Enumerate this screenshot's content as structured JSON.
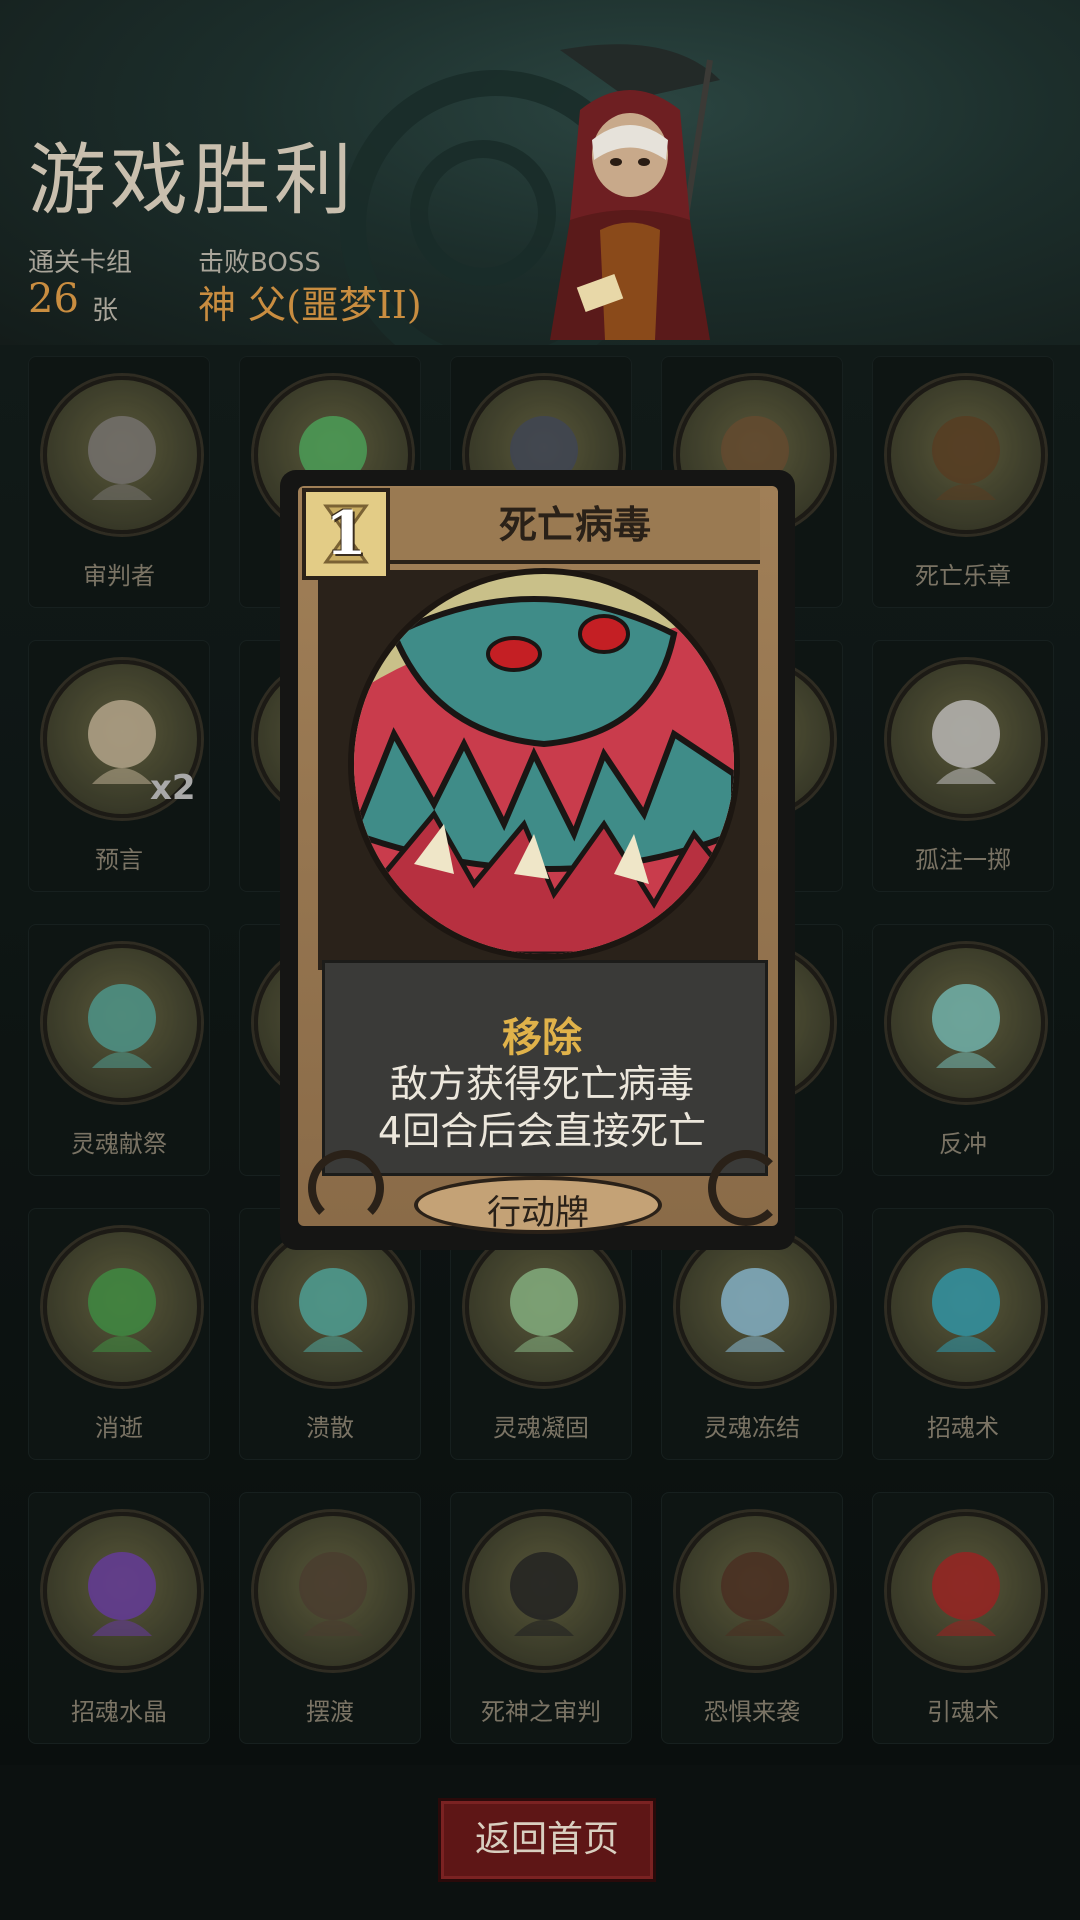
{
  "header": {
    "title": "游戏胜利",
    "cleared_deck_label": "通关卡组",
    "cleared_deck_count": "26",
    "cleared_deck_unit": "张",
    "boss_label": "击败BOSS",
    "boss_name": "神 父(噩梦II)"
  },
  "cards": [
    {
      "name": "审判者",
      "icon": "scythe-icon"
    },
    {
      "name": "",
      "icon": "lantern-icon"
    },
    {
      "name": "",
      "icon": "hooded-figure-icon"
    },
    {
      "name": "",
      "icon": "lute-icon"
    },
    {
      "name": "死亡乐章",
      "icon": "treasure-chest-icon"
    },
    {
      "name": "预言",
      "icon": "prophet-icon",
      "badge": "x2"
    },
    {
      "name": "",
      "icon": "card-icon"
    },
    {
      "name": "",
      "icon": "card-icon"
    },
    {
      "name": "",
      "icon": "card-icon"
    },
    {
      "name": "孤注一掷",
      "icon": "dice-icon"
    },
    {
      "name": "灵魂献祭",
      "icon": "ghost-sacrifice-icon"
    },
    {
      "name": "",
      "icon": "card-icon"
    },
    {
      "name": "",
      "icon": "card-icon"
    },
    {
      "name": "",
      "icon": "card-icon"
    },
    {
      "name": "反冲",
      "icon": "magic-circle-icon"
    },
    {
      "name": "消逝",
      "icon": "vortex-icon"
    },
    {
      "name": "溃散",
      "icon": "skull-ghost-icon"
    },
    {
      "name": "灵魂凝固",
      "icon": "green-ghost-icon"
    },
    {
      "name": "灵魂冻结",
      "icon": "ice-crystal-icon"
    },
    {
      "name": "招魂术",
      "icon": "blue-splash-icon"
    },
    {
      "name": "招魂水晶",
      "icon": "crystal-icon"
    },
    {
      "name": "摆渡",
      "icon": "ferry-boat-icon"
    },
    {
      "name": "死神之审判",
      "icon": "reaper-icon"
    },
    {
      "name": "恐惧来袭",
      "icon": "creature-icon"
    },
    {
      "name": "引魂术",
      "icon": "red-witch-icon"
    }
  ],
  "popup": {
    "cost": "1",
    "title": "死亡病毒",
    "keyword": "移除",
    "desc_line1": "敌方获得死亡病毒",
    "desc_line2": "4回合后会直接死亡",
    "type": "行动牌",
    "icon": "hourglass-icon"
  },
  "footer": {
    "return_label": "返回首页"
  },
  "colors": {
    "accent_orange": "#c98d40",
    "keyword_gold": "#e0b24a",
    "return_red": "#5e1616",
    "card_frame": "#a07f57"
  }
}
